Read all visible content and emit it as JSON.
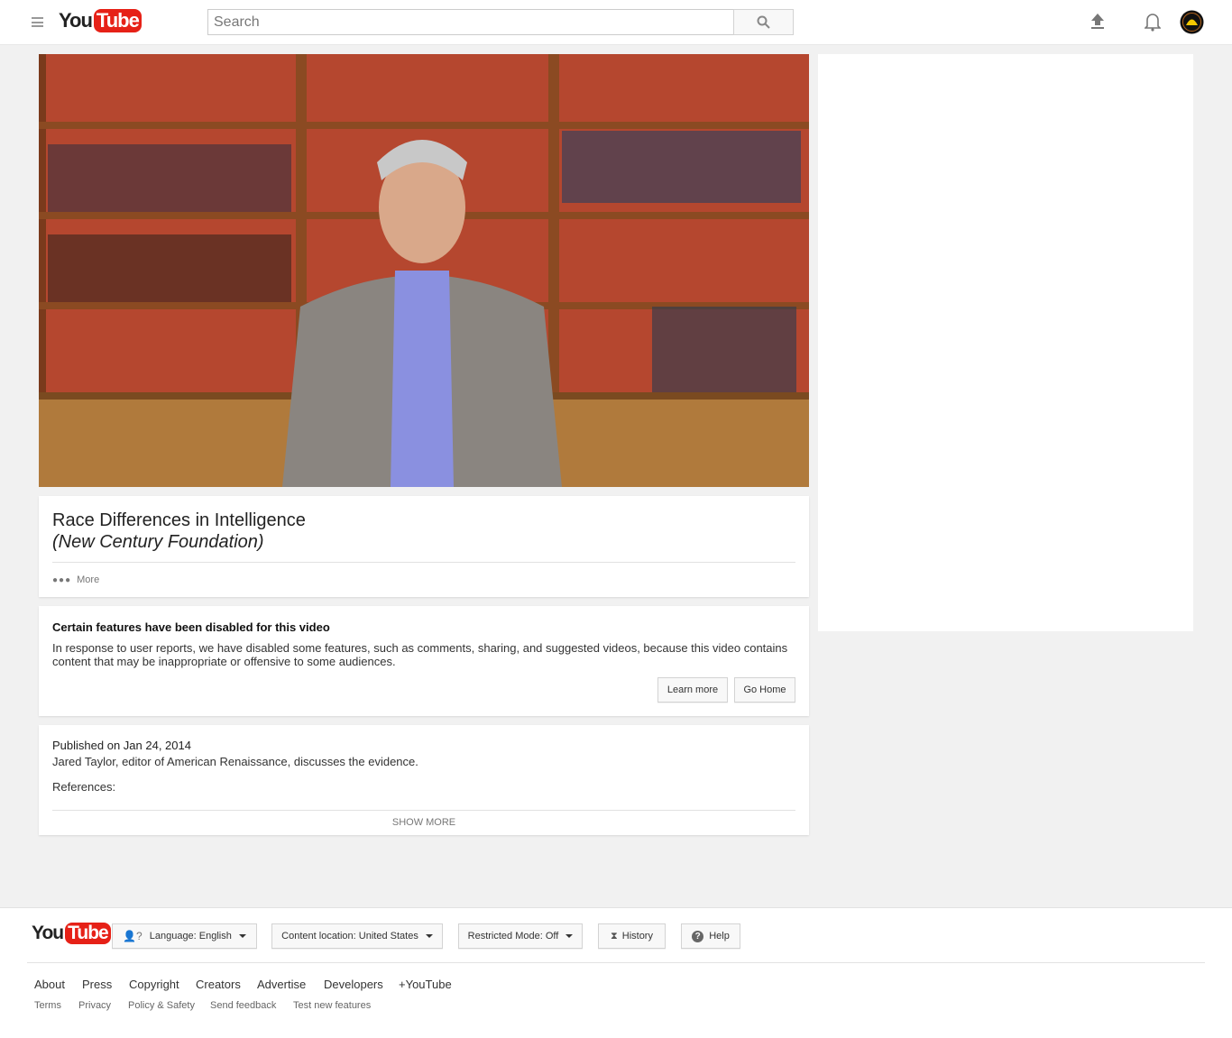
{
  "header": {
    "logo_you": "You",
    "logo_tube": "Tube",
    "search_placeholder": "Search"
  },
  "video": {
    "title": "Race Differences in Intelligence",
    "subtitle": "(New Century Foundation)",
    "more_label": "More"
  },
  "notice": {
    "heading": "Certain features have been disabled for this video",
    "body": "In response to user reports, we have disabled some features, such as comments, sharing, and suggested videos, because this video contains content that may be inappropriate or offensive to some audiences.",
    "learn_more": "Learn more",
    "go_home": "Go Home"
  },
  "description": {
    "published": "Published on Jan 24, 2014",
    "line1": "Jared Taylor, editor of American Renaissance, discusses the evidence.",
    "line2": "References:",
    "show_more": "SHOW MORE"
  },
  "footer": {
    "logo_you": "You",
    "logo_tube": "Tube",
    "language": "Language: English",
    "location": "Content location: United States",
    "restricted": "Restricted Mode: Off",
    "history": "History",
    "help": "Help",
    "links": [
      "About",
      "Press",
      "Copyright",
      "Creators",
      "Advertise",
      "Developers",
      "+YouTube"
    ],
    "sublinks": [
      "Terms",
      "Privacy",
      "Policy & Safety",
      "Send feedback",
      "Test new features"
    ]
  },
  "colors": {
    "brand": "#e62117",
    "background": "#f1f1f1"
  }
}
